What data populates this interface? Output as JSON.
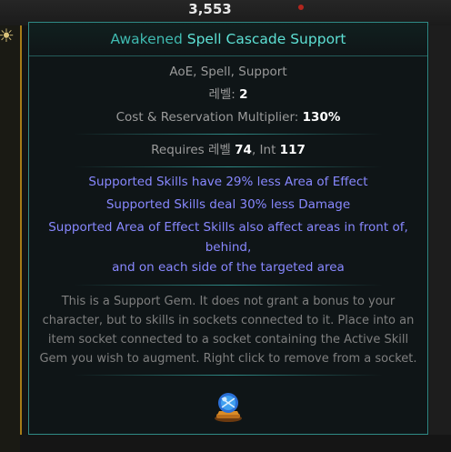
{
  "background": {
    "count": "3,553"
  },
  "tooltip": {
    "title_prefix": "Awakened",
    "title_name": "Spell Cascade Support",
    "tags": "AoE, Spell, Support",
    "level_label": "레벨:",
    "level_value": "2",
    "cost_label": "Cost & Reservation Multiplier:",
    "cost_value": "130%",
    "requires_label": "Requires",
    "req_level_label": "레벨",
    "req_level_value": "74",
    "req_int_label": "Int",
    "req_int_value": "117",
    "mods": [
      "Supported Skills have 29% less Area of Effect",
      "Supported Skills deal 30% less Damage",
      "Supported Area of Effect Skills also affect areas in front of,",
      "behind,",
      "and on each side of the targeted area"
    ],
    "description": [
      "This is a Support Gem. It does not grant a bonus to your",
      "character, but to skills in sockets connected to it. Place into an",
      "item socket connected to a socket containing the Active Skill",
      "Gem you wish to augment. Right click to remove from a socket."
    ],
    "icon": "support-gem-icon"
  },
  "colors": {
    "header_prefix": "#3fbab0",
    "header_name": "#5de0d4",
    "mod_text": "#8888ff",
    "border": "#2f8a86"
  }
}
